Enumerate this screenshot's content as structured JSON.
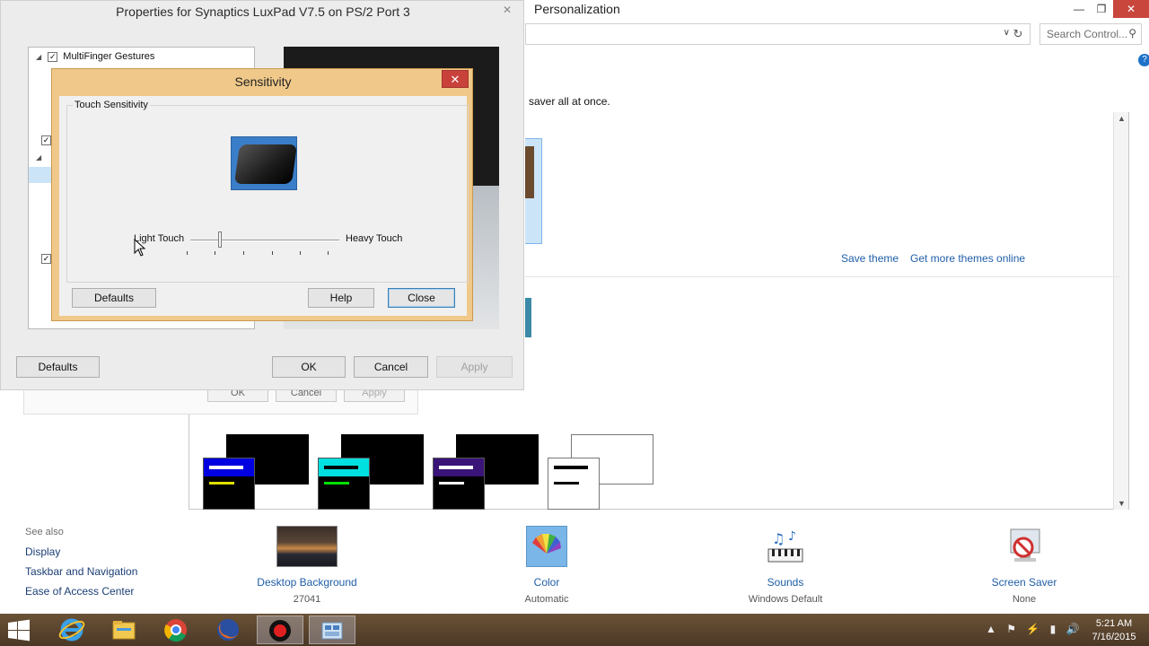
{
  "personalization": {
    "title": "Personalization",
    "search_placeholder": "Search Control...",
    "description_tail": "saver all at once.",
    "save_theme": "Save theme",
    "more_themes": "Get more themes online",
    "see_also": {
      "heading": "See also",
      "links": [
        "Display",
        "Taskbar and Navigation",
        "Ease of Access Center"
      ]
    },
    "bottom_items": [
      {
        "label": "Desktop Background",
        "sub": "27041",
        "icon": "desktop-background-icon"
      },
      {
        "label": "Color",
        "sub": "Automatic",
        "icon": "color-palette-icon"
      },
      {
        "label": "Sounds",
        "sub": "Windows Default",
        "icon": "sounds-icon"
      },
      {
        "label": "Screen Saver",
        "sub": "None",
        "icon": "screen-saver-icon"
      }
    ],
    "high_contrast_colors": [
      {
        "header": "#0000e0",
        "bar1": "#ffffff",
        "bar2": "#e0e000"
      },
      {
        "header": "#00e0e0",
        "bar1": "#000000",
        "bar2": "#00e000"
      },
      {
        "header": "#3a1478",
        "bar1": "#ffffff",
        "bar2": "#ffffff"
      },
      {
        "header": "#ffffff",
        "bar1": "#000000",
        "bar2": "#000000"
      }
    ]
  },
  "ghost_dialog": {
    "ok": "OK",
    "cancel": "Cancel",
    "apply": "Apply"
  },
  "properties": {
    "title": "Properties for Synaptics LuxPad V7.5 on PS/2 Port 3",
    "tree_item": "MultiFinger Gestures",
    "defaults": "Defaults",
    "ok": "OK",
    "cancel": "Cancel",
    "apply": "Apply"
  },
  "sensitivity": {
    "title": "Sensitivity",
    "group_label": "Touch Sensitivity",
    "light_label": "Light Touch",
    "heavy_label": "Heavy Touch",
    "slider_value_percent": 20,
    "defaults": "Defaults",
    "help": "Help",
    "close": "Close"
  },
  "taskbar": {
    "apps": [
      "internet-explorer-icon",
      "file-explorer-icon",
      "chrome-icon",
      "firefox-icon",
      "record-icon",
      "control-panel-icon"
    ],
    "time": "5:21 AM",
    "date": "7/16/2015"
  },
  "colors": {
    "sensitivity_frame": "#f0c98a",
    "close_red": "#c8423b",
    "link_blue": "#1f5ea8",
    "taskbar": "#5a4430"
  }
}
